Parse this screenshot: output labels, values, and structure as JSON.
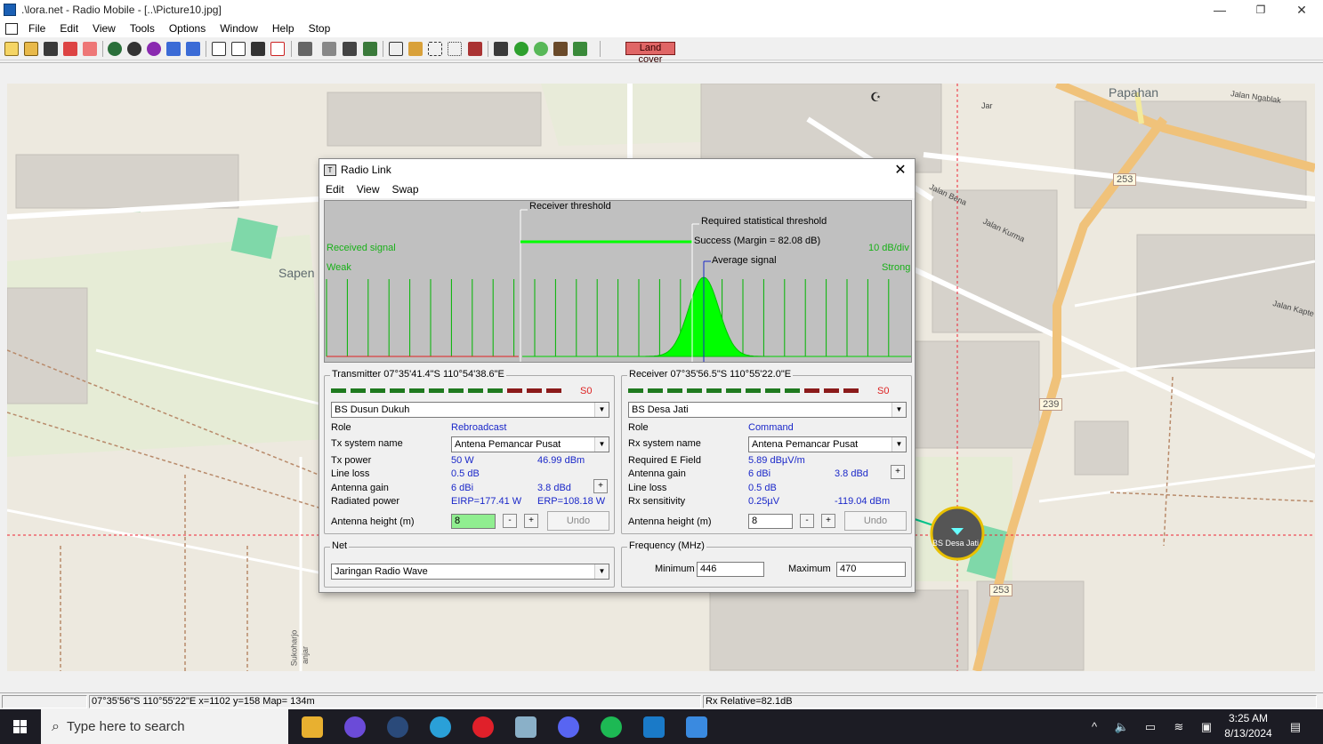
{
  "window": {
    "title": ".\\lora.net - Radio Mobile - [..\\Picture10.jpg]",
    "minimize": "—",
    "maximize": "❐",
    "close": "✕"
  },
  "menu": [
    "File",
    "Edit",
    "View",
    "Tools",
    "Options",
    "Window",
    "Help",
    "Stop"
  ],
  "toolbar": {
    "landcover_label": "Land cover"
  },
  "map": {
    "labels": {
      "papahan": "Papahan",
      "sapen": "Sapen",
      "jalan_ngablak": "Jalan Ngablak",
      "jalan_bena": "Jalan Bena",
      "jalan_kurma": "Jalan Kurma",
      "jalan_kapte": "Jalan Kapte",
      "road_253a": "253",
      "road_239": "239",
      "road_253b": "253",
      "sukoharjo": "Sukoharjo",
      "jar": "Jar",
      "sanjar": "anjar"
    },
    "station_label": "BS Desa Jati"
  },
  "dialog": {
    "title": "Radio Link",
    "menu": [
      "Edit",
      "View",
      "Swap"
    ],
    "chart": {
      "receiver_threshold": "Receiver threshold",
      "required_threshold": "Required statistical threshold",
      "success": "Success (Margin = 82.08 dB)",
      "average_signal": "Average signal",
      "received_signal": "Received signal",
      "weak": "Weak",
      "strong": "Strong",
      "scale": "10 dB/div"
    },
    "transmitter": {
      "header": "Transmitter 07°35'41.4\"S 110°54'38.6\"E",
      "s_level": "S0",
      "unit": "BS Dusun Dukuh",
      "role_label": "Role",
      "role": "Rebroadcast",
      "system_label": "Tx system name",
      "system": "Antena Pemancar Pusat",
      "power_label": "Tx power",
      "power_w": "50 W",
      "power_dbm": "46.99 dBm",
      "line_loss_label": "Line loss",
      "line_loss": "0.5 dB",
      "gain_label": "Antenna gain",
      "gain_dbi": "6 dBi",
      "gain_dbd": "3.8 dBd",
      "radiated_label": "Radiated power",
      "eirp": "EIRP=177.41 W",
      "erp": "ERP=108.18 W",
      "height_label": "Antenna height (m)",
      "height": "8",
      "undo": "Undo"
    },
    "receiver": {
      "header": "Receiver 07°35'56.5\"S 110°55'22.0\"E",
      "s_level": "S0",
      "unit": "BS Desa Jati",
      "role_label": "Role",
      "role": "Command",
      "system_label": "Rx system name",
      "system": "Antena Pemancar Pusat",
      "efield_label": "Required E Field",
      "efield": "5.89 dBµV/m",
      "gain_label": "Antenna gain",
      "gain_dbi": "6 dBi",
      "gain_dbd": "3.8 dBd",
      "line_loss_label": "Line loss",
      "line_loss": "0.5 dB",
      "sens_label": "Rx sensitivity",
      "sens_uv": "0.25µV",
      "sens_dbm": "-119.04 dBm",
      "height_label": "Antenna height (m)",
      "height": "8",
      "undo": "Undo"
    },
    "net": {
      "header": "Net",
      "value": "Jaringan Radio Wave"
    },
    "frequency": {
      "header": "Frequency (MHz)",
      "min_label": "Minimum",
      "min": "446",
      "max_label": "Maximum",
      "max": "470"
    }
  },
  "status": {
    "coords": "07°35'56\"S  110°55'22\"E   x=1102 y=158 Map= 134m",
    "relative": "Rx Relative=82.1dB"
  },
  "taskbar": {
    "search_placeholder": "Type here to search",
    "time": "3:25 AM",
    "date": "8/13/2024"
  }
}
